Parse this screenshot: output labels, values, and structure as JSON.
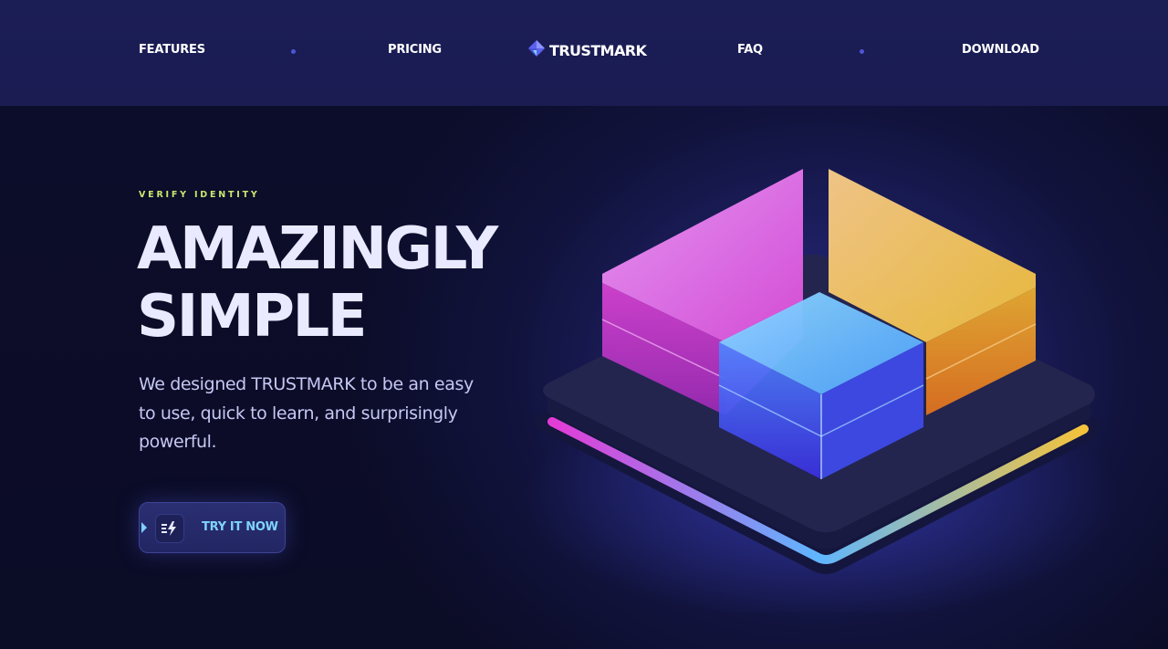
{
  "brand": {
    "name": "TRUSTMARK",
    "logo_icon": "diamond-logo-icon"
  },
  "nav": {
    "items": [
      {
        "label": "FEATURES"
      },
      {
        "label": "PRICING"
      },
      {
        "label": "FAQ"
      },
      {
        "label": "DOWNLOAD"
      }
    ]
  },
  "hero": {
    "eyebrow": "VERIFY IDENTITY",
    "headline_line1": "AMAZINGLY",
    "headline_line2": "SIMPLE",
    "description": "We designed TRUSTMARK to be an easy to use, quick to learn, and surprisingly powerful.",
    "cta_label": "TRY IT NOW",
    "cta_icon": "lightning-icon"
  },
  "colors": {
    "header_bg": "#1b1d55",
    "page_bg": "#0b0c26",
    "eyebrow": "#c9e86f",
    "headline": "#e9eaff",
    "cta_text": "#7fd4ff",
    "pink": "#e33bd6",
    "yellow": "#f5c33a",
    "blue": "#4b6cff"
  }
}
